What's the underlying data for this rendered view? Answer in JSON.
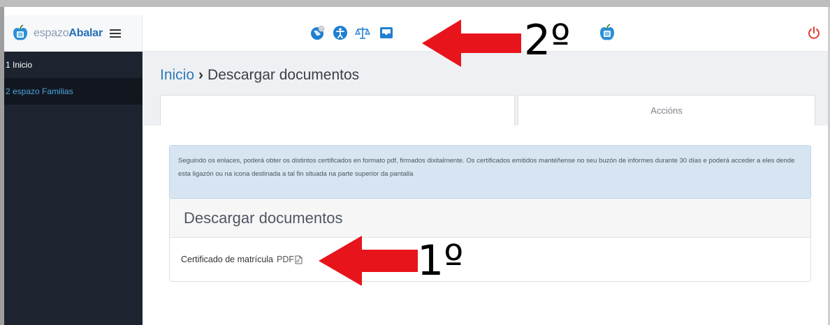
{
  "brand": {
    "name_light": "espazo",
    "name_bold": "Abalar",
    "logo_icon": "apple-tablet-logo-icon",
    "menu_icon": "hamburger-menu-icon"
  },
  "sidebar": {
    "items": [
      {
        "label": "1 Inicio"
      },
      {
        "label": "2 espazo Familias"
      }
    ]
  },
  "topbar": {
    "icons": [
      "help-globe-icon",
      "accessibility-icon",
      "legal-scales-icon",
      "inbox-tray-icon",
      "abalar-apple-icon",
      "power-icon"
    ]
  },
  "annotations": {
    "second": "2º",
    "first": "1º"
  },
  "breadcrumb": {
    "root": "Inicio",
    "separator": "›",
    "current": "Descargar documentos"
  },
  "table": {
    "headers": [
      "",
      "Accións"
    ]
  },
  "info": {
    "text": "Seguindo os enlaces, poderá obter os distintos certificados en formato pdf, firmados dixitalmente. Os certificados emitidos mantéñense no seu buzón de informes durante 30 días e poderá acceder a eles dende esta ligazón ou na icona destinada a tal fin situada na parte superior da pantalla"
  },
  "panel": {
    "title": "Descargar documentos",
    "rows": [
      {
        "label": "Certificado de matrícula",
        "link": "PDF"
      }
    ]
  },
  "colors": {
    "sidebar_bg": "#1d2430",
    "link_blue": "#2f7ab8",
    "info_bg": "#d6e5f1",
    "arrow_red": "#e8141b",
    "power_red": "#e23b2e"
  }
}
